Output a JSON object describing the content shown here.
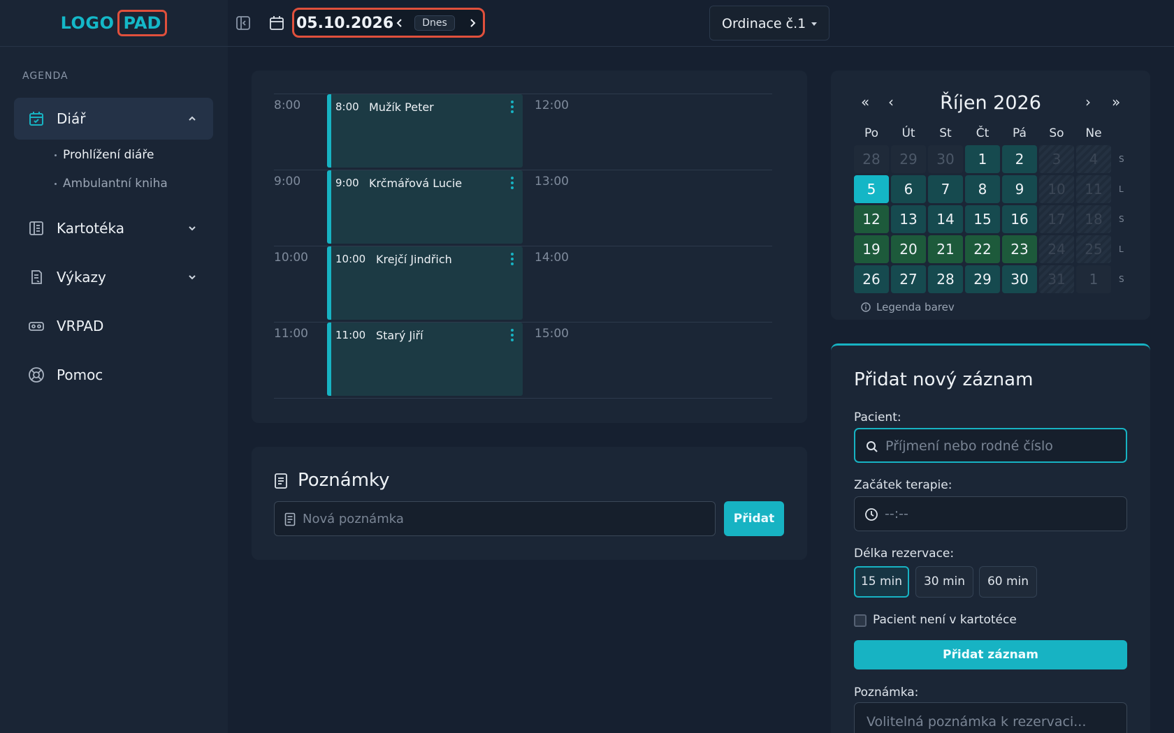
{
  "logo": {
    "part1": "LOGO",
    "part2": "PAD"
  },
  "sidebar": {
    "section": "AGENDA",
    "items": [
      {
        "label": "Diář",
        "icon": "calendar-check-icon",
        "expanded": true,
        "children": [
          {
            "label": "Prohlížení diáře"
          },
          {
            "label": "Ambulantní kniha"
          }
        ]
      },
      {
        "label": "Kartotéka",
        "icon": "card-index-icon"
      },
      {
        "label": "Výkazy",
        "icon": "report-icon"
      },
      {
        "label": "VRPAD",
        "icon": "vr-headset-icon"
      },
      {
        "label": "Pomoc",
        "icon": "lifebuoy-icon"
      }
    ]
  },
  "topbar": {
    "date": "05.10.2026",
    "today_label": "Dnes",
    "office": "Ordinace č.1"
  },
  "schedule": {
    "left_times": [
      "8:00",
      "9:00",
      "10:00",
      "11:00"
    ],
    "right_times": [
      "12:00",
      "13:00",
      "14:00",
      "15:00"
    ],
    "appointments": [
      {
        "time": "8:00",
        "name": "Mužík Peter"
      },
      {
        "time": "9:00",
        "name": "Krčmářová Lucie"
      },
      {
        "time": "10:00",
        "name": "Krejčí Jindřich"
      },
      {
        "time": "11:00",
        "name": "Starý Jiří"
      }
    ]
  },
  "notes": {
    "title": "Poznámky",
    "placeholder": "Nová poznámka",
    "add_label": "Přidat"
  },
  "calendar": {
    "prev_year": "«",
    "prev_month": "‹",
    "next_month": "›",
    "next_year": "»",
    "title": "Říjen 2026",
    "weekdays": [
      "Po",
      "Út",
      "St",
      "Čt",
      "Pá",
      "So",
      "Ne"
    ],
    "weeks": [
      [
        [
          "28",
          "out"
        ],
        [
          "29",
          "out"
        ],
        [
          "30",
          "out"
        ],
        [
          "1",
          "cur"
        ],
        [
          "2",
          "cur"
        ],
        [
          "3",
          "wkend"
        ],
        [
          "4",
          "wkend"
        ]
      ],
      [
        [
          "5",
          "today"
        ],
        [
          "6",
          "cur"
        ],
        [
          "7",
          "cur"
        ],
        [
          "8",
          "cur"
        ],
        [
          "9",
          "cur"
        ],
        [
          "10",
          "wkend"
        ],
        [
          "11",
          "wkend"
        ]
      ],
      [
        [
          "12",
          "green"
        ],
        [
          "13",
          "cur"
        ],
        [
          "14",
          "cur"
        ],
        [
          "15",
          "cur"
        ],
        [
          "16",
          "cur"
        ],
        [
          "17",
          "wkend"
        ],
        [
          "18",
          "wkend"
        ]
      ],
      [
        [
          "19",
          "green"
        ],
        [
          "20",
          "green"
        ],
        [
          "21",
          "green"
        ],
        [
          "22",
          "green"
        ],
        [
          "23",
          "green"
        ],
        [
          "24",
          "wkend"
        ],
        [
          "25",
          "wkend"
        ]
      ],
      [
        [
          "26",
          "cur"
        ],
        [
          "27",
          "cur"
        ],
        [
          "28",
          "cur"
        ],
        [
          "29",
          "cur"
        ],
        [
          "30",
          "cur"
        ],
        [
          "31",
          "wkend"
        ],
        [
          "1",
          "out"
        ]
      ]
    ],
    "week_marks": [
      "S",
      "L",
      "S",
      "L",
      "S"
    ],
    "legend": "Legenda barev"
  },
  "add_record": {
    "title": "Přidat nový záznam",
    "patient_label": "Pacient:",
    "patient_placeholder": "Příjmení nebo rodné číslo",
    "start_label": "Začátek terapie:",
    "start_placeholder": "--:--",
    "duration_label": "Délka rezervace:",
    "durations": [
      "15 min",
      "30 min",
      "60 min"
    ],
    "selected_duration": "15 min",
    "not_in_registry": "Pacient není v kartotéce",
    "submit_label": "Přidat záznam",
    "note_label": "Poznámka:",
    "note_placeholder": "Volitelná poznámka k rezervaci..."
  },
  "colors": {
    "accent": "#17b3c3",
    "highlight": "#e0503c",
    "green": "#1d5a3b"
  }
}
